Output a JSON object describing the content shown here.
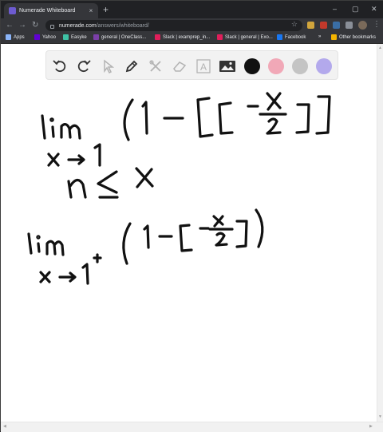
{
  "browser": {
    "tab_title": "Numerade Whiteboard",
    "tab_close": "×",
    "new_tab": "+",
    "window_controls": [
      "–",
      "▢",
      "✕"
    ],
    "url_host": "numerade.com",
    "url_path": "/answers/whiteboard/"
  },
  "bookmarks": [
    {
      "label": "Apps",
      "color": "#8ab4f8"
    },
    {
      "label": "Yahoo",
      "color": "#6001d2"
    },
    {
      "label": "Easyke",
      "color": "#3ec1a5"
    },
    {
      "label": "general | OneClass...",
      "color": "#7b3fa8"
    },
    {
      "label": "Slack | examprep_in...",
      "color": "#e01e5a"
    },
    {
      "label": "Slack | general | Exo...",
      "color": "#e01e5a"
    },
    {
      "label": "Facebook",
      "color": "#1877f2"
    },
    {
      "label": "»",
      "color": ""
    },
    {
      "label": "Other bookmarks",
      "color": "#f4b400"
    }
  ],
  "toolbar": {
    "tools": [
      "undo-icon",
      "redo-icon",
      "pointer-icon",
      "pen-icon",
      "tools-icon",
      "eraser-icon",
      "text-icon",
      "image-icon"
    ],
    "text_tool_label": "A",
    "colors": [
      "#111111",
      "#f1a8b7",
      "#c4c4c4",
      "#b3a9ec"
    ]
  }
}
